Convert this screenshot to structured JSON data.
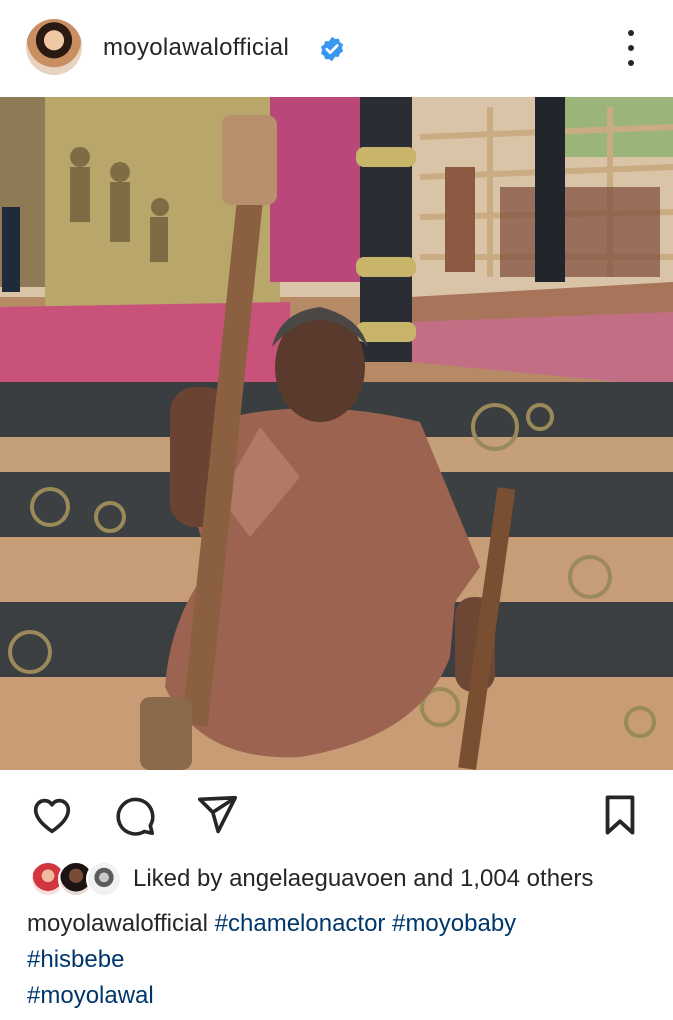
{
  "post": {
    "username": "moyolawalofficial",
    "verified": true,
    "icons": {
      "verified": "verified-badge-icon",
      "more": "more-options-icon",
      "like": "heart-icon",
      "comment": "comment-icon",
      "share": "send-icon",
      "save": "bookmark-icon"
    }
  },
  "likes": {
    "prefix": "Liked by ",
    "user": "angelaeguavoen",
    "suffix": " and 1,004 others"
  },
  "caption": {
    "username": "moyolawalofficial",
    "tags": [
      "#chamelonactor",
      "#moyobaby",
      "#hisbebe",
      "#moyolawal"
    ]
  },
  "colors": {
    "verified": "#3897f0",
    "hashtag": "#00376b",
    "text": "#262626"
  }
}
